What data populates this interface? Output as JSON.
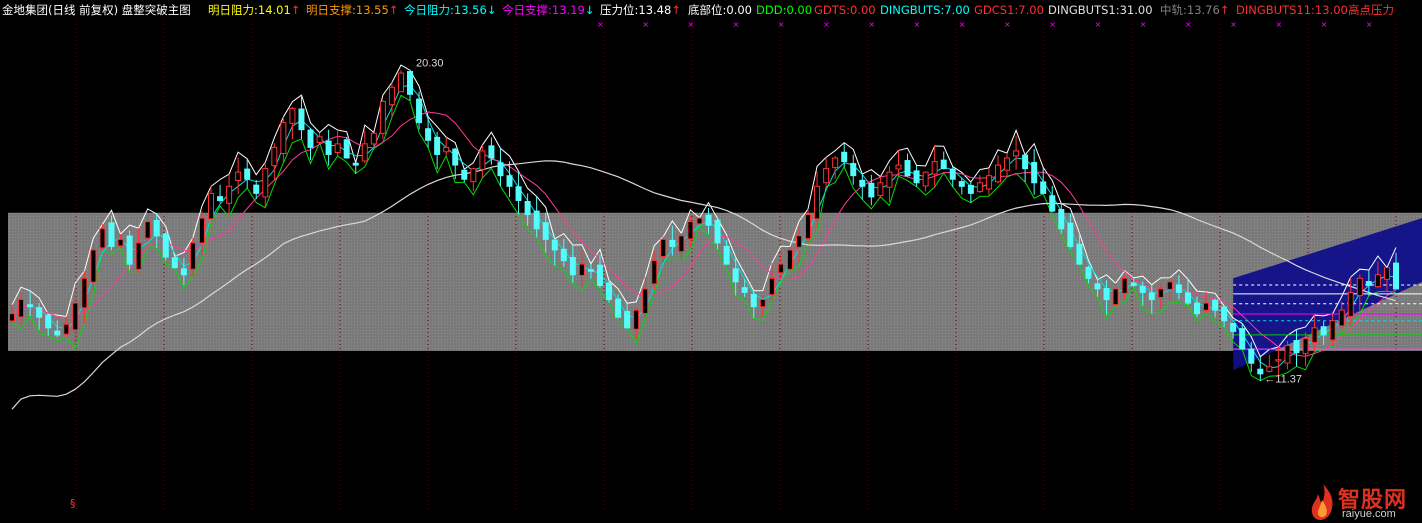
{
  "header": {
    "title": "金地集团(日线 前复权) 盘整突破主图",
    "items": [
      {
        "label": "明日阻力:14.01",
        "arrow": "↑",
        "color": "#ffff00"
      },
      {
        "label": "明日支撑:13.55",
        "arrow": "↑",
        "color": "#ff9900"
      },
      {
        "label": "今日阻力:13.56",
        "arrow": "↓",
        "color": "#00ffff"
      },
      {
        "label": "今日支撑:13.19",
        "arrow": "↓",
        "color": "#ff00ff"
      },
      {
        "label": "压力位:13.48",
        "arrow": "↑",
        "color": "#ffffff"
      },
      {
        "label": "底部位:0.00",
        "arrow": "",
        "color": "#ffffff"
      },
      {
        "label": "DDD:0.00",
        "arrow": "",
        "color": "#00ff00"
      },
      {
        "label": "GDTS:0.00",
        "arrow": "",
        "color": "#ff3030"
      },
      {
        "label": "DINGBUTS:7.00",
        "arrow": "",
        "color": "#00ffff"
      },
      {
        "label": "GDCS1:7.00",
        "arrow": "",
        "color": "#ff3030"
      },
      {
        "label": "DINGBUTS1:31.00",
        "arrow": "",
        "color": "#e0e0e0"
      },
      {
        "label": "中轨:13.76",
        "arrow": "↑",
        "color": "#808080"
      },
      {
        "label": "DINGBUTS11:13.00",
        "arrow": "",
        "color": "#ff3030"
      },
      {
        "label": "高点压力",
        "arrow": "",
        "color": "#ff3030"
      }
    ]
  },
  "annotations": {
    "high_label": "20.30",
    "low_label": "←11.37"
  },
  "footer": {
    "mark": "§"
  },
  "watermark": {
    "brand": "智股网",
    "domain": "raiyue.com"
  },
  "colors": {
    "up": "#ff3232",
    "down": "#54fcfc",
    "band_fill": "#7a7a7a",
    "channel": "#10108a"
  },
  "chart_data": {
    "type": "candlestick",
    "title": "金地集团(日线 前复权) 盘整突破主图",
    "xlabel": "",
    "ylabel": "",
    "ylim": [
      8.5,
      21.5
    ],
    "grid": false,
    "annotated_high": 20.3,
    "annotated_low": 11.37,
    "consolidation_band": [
      12.15,
      16.05
    ],
    "levels": {
      "明日阻力": 14.01,
      "明日支撑": 13.55,
      "今日阻力": 13.56,
      "今日支撑": 13.19,
      "压力位": 13.48,
      "中轨": 13.76
    },
    "series": [
      {
        "name": "close",
        "values": [
          13.2,
          13.6,
          13.4,
          13.1,
          12.8,
          12.6,
          12.9,
          13.5,
          14.2,
          15.0,
          15.6,
          15.1,
          15.3,
          14.6,
          15.2,
          15.8,
          15.4,
          14.8,
          14.5,
          14.3,
          15.2,
          15.9,
          16.6,
          16.4,
          16.8,
          17.2,
          17.0,
          16.6,
          17.3,
          17.9,
          18.6,
          19.0,
          18.4,
          17.9,
          18.2,
          17.7,
          18.0,
          17.6,
          17.4,
          18.0,
          18.3,
          19.2,
          19.6,
          20.0,
          19.4,
          18.6,
          18.1,
          17.7,
          17.9,
          17.4,
          17.0,
          17.3,
          17.8,
          17.6,
          17.1,
          16.8,
          16.4,
          16.0,
          15.6,
          15.3,
          15.0,
          14.7,
          14.3,
          14.6,
          14.4,
          14.0,
          13.6,
          13.1,
          12.8,
          13.3,
          13.9,
          14.7,
          15.3,
          15.1,
          15.4,
          15.8,
          15.9,
          15.7,
          15.2,
          14.6,
          14.1,
          13.8,
          13.4,
          13.6,
          14.2,
          14.6,
          15.0,
          15.4,
          16.0,
          16.8,
          17.3,
          17.6,
          17.5,
          17.1,
          16.8,
          16.5,
          16.9,
          17.2,
          17.4,
          17.1,
          16.9,
          17.2,
          17.5,
          17.3,
          17.0,
          16.8,
          16.6,
          16.9,
          17.1,
          17.4,
          17.6,
          17.8,
          17.3,
          16.9,
          16.6,
          16.1,
          15.6,
          15.1,
          14.6,
          14.2,
          13.9,
          13.6,
          13.9,
          14.2,
          14.0,
          13.8,
          13.6,
          13.9,
          14.1,
          13.8,
          13.5,
          13.2,
          13.5,
          13.3,
          13.0,
          12.7,
          12.2,
          11.8,
          11.5,
          11.7,
          11.9,
          12.3,
          12.1,
          12.5,
          12.8,
          12.6,
          13.0,
          13.3,
          13.8,
          14.2,
          14.0,
          14.3,
          14.5,
          13.9
        ]
      }
    ]
  }
}
